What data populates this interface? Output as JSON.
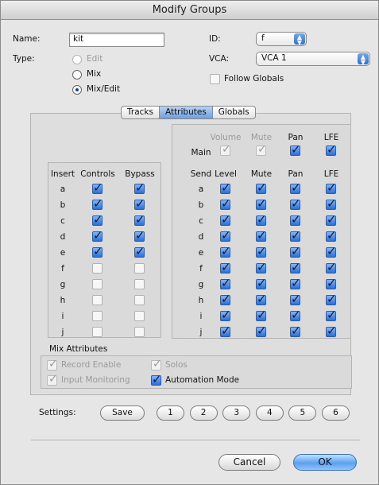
{
  "window": {
    "title": "Modify Groups"
  },
  "name": {
    "label": "Name:",
    "value": "kit"
  },
  "type": {
    "label": "Type:",
    "options": [
      {
        "label": "Edit",
        "checked": false,
        "enabled": false
      },
      {
        "label": "Mix",
        "checked": false,
        "enabled": true
      },
      {
        "label": "Mix/Edit",
        "checked": true,
        "enabled": true
      }
    ]
  },
  "id": {
    "label": "ID:",
    "value": "f"
  },
  "vca": {
    "label": "VCA:",
    "value": "VCA 1"
  },
  "follow_globals": {
    "label": "Follow Globals",
    "checked": false
  },
  "tabs": [
    {
      "label": "Tracks"
    },
    {
      "label": "Attributes"
    },
    {
      "label": "Globals"
    }
  ],
  "active_tab": "Attributes",
  "main": {
    "label": "Main",
    "headers": [
      "Volume",
      "Mute",
      "Pan",
      "LFE"
    ],
    "states": [
      "disabled-checked",
      "disabled-checked",
      "checked",
      "checked"
    ]
  },
  "inserts": {
    "headers": [
      "Insert",
      "Controls",
      "Bypass"
    ],
    "rows": [
      {
        "id": "a",
        "controls": true,
        "bypass": true
      },
      {
        "id": "b",
        "controls": true,
        "bypass": true
      },
      {
        "id": "c",
        "controls": true,
        "bypass": true
      },
      {
        "id": "d",
        "controls": true,
        "bypass": true
      },
      {
        "id": "e",
        "controls": true,
        "bypass": true
      },
      {
        "id": "f",
        "controls": false,
        "bypass": false
      },
      {
        "id": "g",
        "controls": false,
        "bypass": false
      },
      {
        "id": "h",
        "controls": false,
        "bypass": false
      },
      {
        "id": "i",
        "controls": false,
        "bypass": false
      },
      {
        "id": "j",
        "controls": false,
        "bypass": false
      }
    ]
  },
  "sends": {
    "headers": [
      "Send",
      "Level",
      "Mute",
      "Pan",
      "LFE"
    ],
    "rows": [
      {
        "id": "a",
        "checks": [
          true,
          true,
          true,
          true
        ]
      },
      {
        "id": "b",
        "checks": [
          true,
          true,
          true,
          true
        ]
      },
      {
        "id": "c",
        "checks": [
          true,
          true,
          true,
          true
        ]
      },
      {
        "id": "d",
        "checks": [
          true,
          true,
          true,
          true
        ]
      },
      {
        "id": "e",
        "checks": [
          true,
          true,
          true,
          true
        ]
      },
      {
        "id": "f",
        "checks": [
          true,
          true,
          true,
          true
        ]
      },
      {
        "id": "g",
        "checks": [
          true,
          true,
          true,
          true
        ]
      },
      {
        "id": "h",
        "checks": [
          true,
          true,
          true,
          true
        ]
      },
      {
        "id": "i",
        "checks": [
          true,
          true,
          true,
          true
        ]
      },
      {
        "id": "j",
        "checks": [
          true,
          true,
          true,
          true
        ]
      }
    ]
  },
  "mix_attributes": {
    "title": "Mix Attributes",
    "record_enable": {
      "label": "Record Enable",
      "state": "disabled-checked"
    },
    "input_monitoring": {
      "label": "Input Monitoring",
      "state": "disabled-checked"
    },
    "solos": {
      "label": "Solos",
      "state": "disabled-checked"
    },
    "automation_mode": {
      "label": "Automation Mode",
      "state": "checked"
    }
  },
  "settings": {
    "label": "Settings:",
    "save_label": "Save",
    "slots": [
      "1",
      "2",
      "3",
      "4",
      "5",
      "6"
    ]
  },
  "buttons": {
    "cancel": "Cancel",
    "ok": "OK"
  },
  "colors": {
    "accent": "#2b6fd6",
    "dialog_bg": "#e6e6e6"
  }
}
